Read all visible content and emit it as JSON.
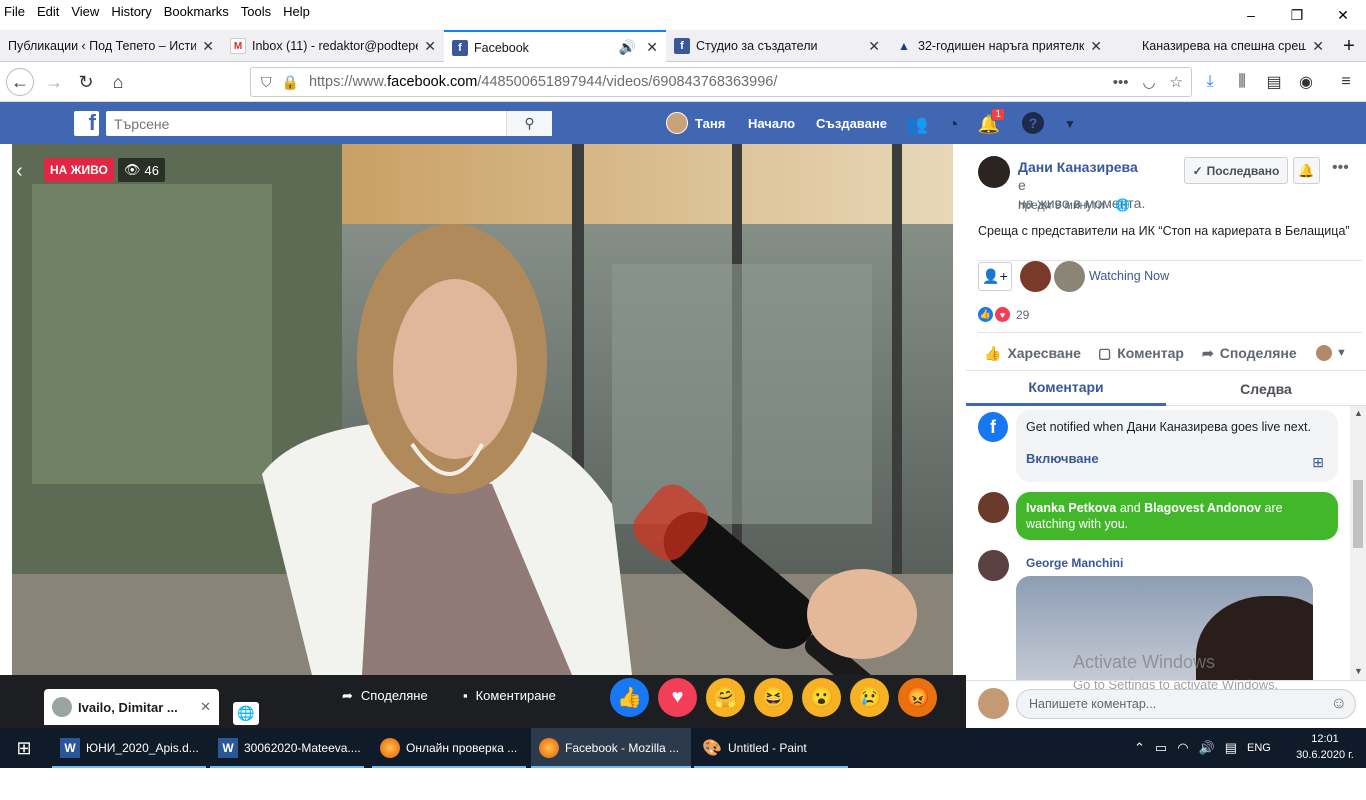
{
  "menu": [
    "File",
    "Edit",
    "View",
    "History",
    "Bookmarks",
    "Tools",
    "Help"
  ],
  "window_controls": {
    "minimize": "–",
    "restore": "❐",
    "close": "✕"
  },
  "tabs": [
    {
      "title": "Публикации ‹ Под Тепето – Исти",
      "favicon": "wp-icon",
      "active": false
    },
    {
      "title": "Inbox (11) - redaktor@podtepe",
      "favicon": "gmail-icon",
      "active": false
    },
    {
      "title": "Facebook",
      "favicon": "facebook-icon",
      "active": true
    },
    {
      "title": "Студио за създатели",
      "favicon": "facebook-icon",
      "active": false
    },
    {
      "title": "32-годишен наръга приятелк",
      "favicon": "news-icon",
      "active": false
    },
    {
      "title": "Каназирева на спешна среща",
      "favicon": "none",
      "active": false
    }
  ],
  "url": {
    "prefix": "https://www.",
    "domain": "facebook.com",
    "path": "/448500651897944/videos/690843768363996/"
  },
  "fb": {
    "search_placeholder": "Търсене",
    "user": "Таня",
    "home": "Начало",
    "create": "Създаване",
    "notif_count": "1"
  },
  "video": {
    "live_label": "НА ЖИВО",
    "viewers": "46",
    "watcher_chip": "Ivailo, Dimitar ...",
    "share_label": "Споделяне",
    "comment_label": "Коментиране"
  },
  "post": {
    "author": "Дани Каназирева",
    "live_suffix": "е",
    "live_line": "на живо в момента.",
    "time": "преди 9 минути ·",
    "follow_button": "Последвано",
    "text": "Среща с представители на ИК “Стоп на кариерата в Белащица”",
    "watching_now": "Watching Now",
    "reactions_count": "29",
    "like_label": "Харесване",
    "comment_label": "Коментар",
    "share_label": "Споделяне",
    "tab_comments": "Коментари",
    "tab_follow": "Следва"
  },
  "comments": {
    "notify_text": "Get notified when Дани Каназирева goes live next.",
    "notify_action": "Включване",
    "watching_names_1": "Ivanka Petkova",
    "watching_and": " and ",
    "watching_names_2": "Blagovest Andonov",
    "watching_tail": " are watching with you.",
    "commenter": "George Manchini",
    "input_placeholder": "Напишете коментар..."
  },
  "watermark": {
    "line1": "Activate Windows",
    "line2": "Go to Settings to activate Windows."
  },
  "taskbar": {
    "items": [
      {
        "label": "ЮНИ_2020_Apis.d...",
        "icon": "word-icon",
        "active": false
      },
      {
        "label": "30062020-Mateeva....",
        "icon": "word-icon",
        "active": false
      },
      {
        "label": "Онлайн проверка ...",
        "icon": "firefox-icon",
        "active": false
      },
      {
        "label": "Facebook - Mozilla ...",
        "icon": "firefox-icon",
        "active": true
      },
      {
        "label": "Untitled - Paint",
        "icon": "paint-icon",
        "active": false
      }
    ],
    "lang": "ENG",
    "time": "12:01",
    "date": "30.6.2020 г."
  },
  "colors": {
    "fb_blue": "#4267b2",
    "live_red": "#e42645",
    "bubble_green": "#42b72a",
    "link_blue": "#385898"
  }
}
